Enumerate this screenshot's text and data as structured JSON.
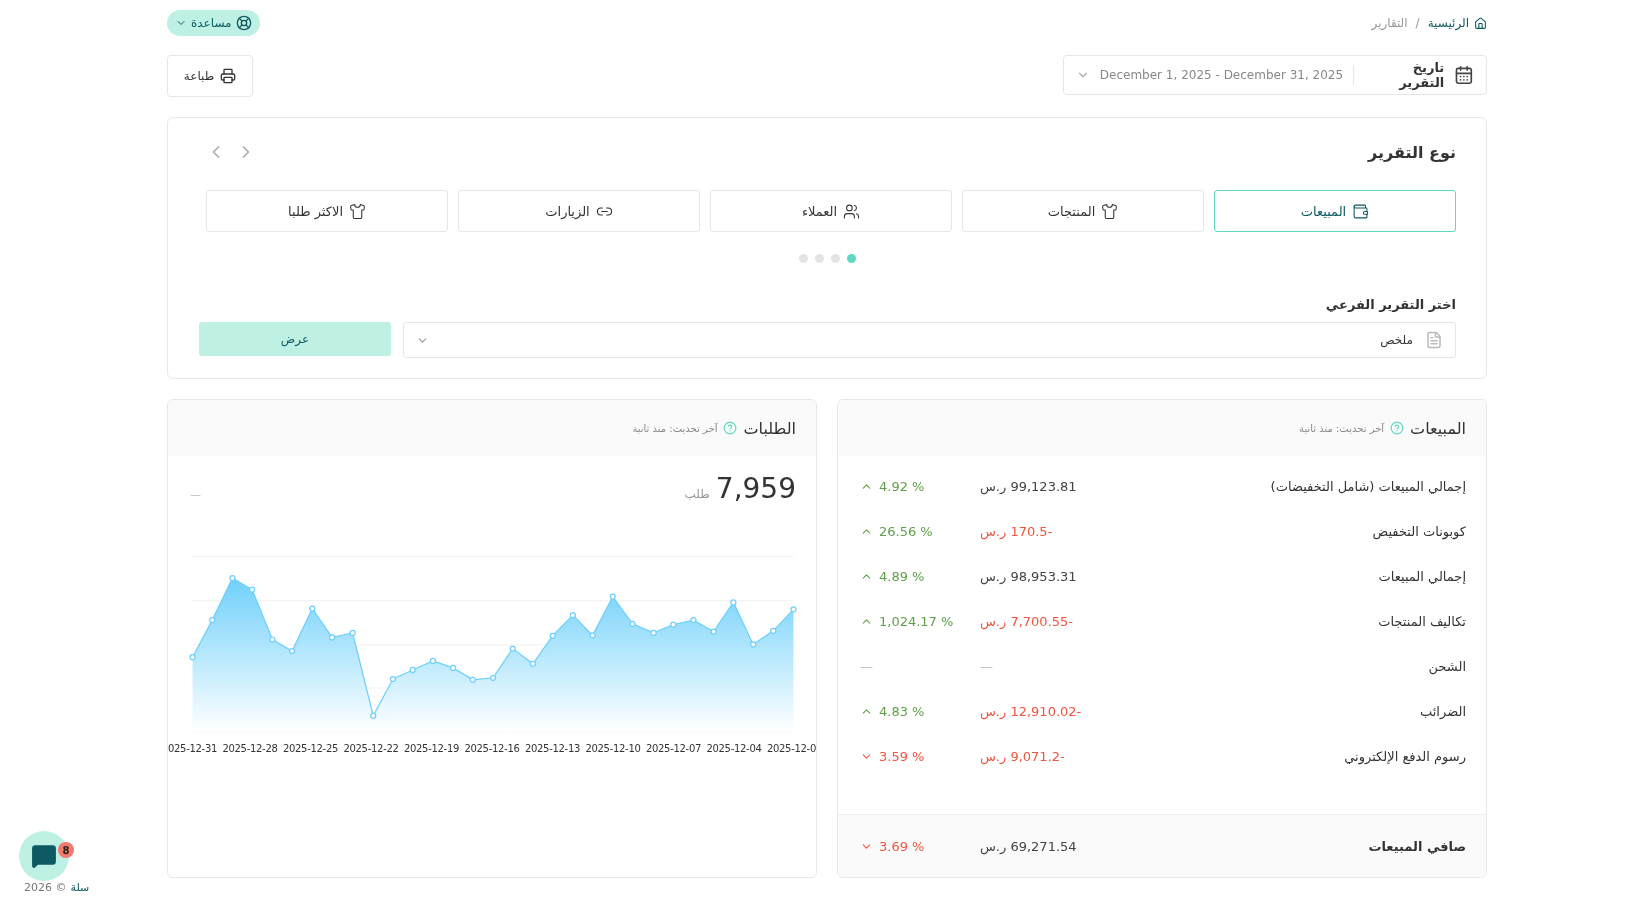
{
  "breadcrumb": {
    "home": "الرئيسية",
    "separator": "/",
    "current": "التقارير"
  },
  "help_button": {
    "label": "مساعدة"
  },
  "date_picker": {
    "label": "تاريخ التقرير",
    "value": "December 1, 2025 - December 31, 2025"
  },
  "print_button": {
    "label": "طباعة"
  },
  "report_type": {
    "title": "نوع التقرير",
    "tabs": [
      {
        "label": "المبيعات",
        "kind": "wallet",
        "selected": true
      },
      {
        "label": "المنتجات",
        "kind": "shirt",
        "selected": false
      },
      {
        "label": "العملاء",
        "kind": "users",
        "selected": false
      },
      {
        "label": "الزيارات",
        "kind": "link",
        "selected": false
      },
      {
        "label": "الاكثر طلبا",
        "kind": "shirt",
        "selected": false
      }
    ],
    "pager_dots": [
      {
        "selected": true
      },
      {
        "selected": false
      },
      {
        "selected": false
      },
      {
        "selected": false
      }
    ],
    "subreport_label": "اختر التقرير الفرعي",
    "subreport_value": "ملخص",
    "show_button": "عرض"
  },
  "sales_card": {
    "title": "المبيعات",
    "updated": "آخر تحديث: منذ ثانية",
    "rows": [
      {
        "label": "إجمالي المبيعات (شامل التخفيضات)",
        "amount": "99,123.81 ر.س",
        "negative": false,
        "change": "4.92 %",
        "rising": true,
        "kind": "row"
      },
      {
        "label": "كوبونات التخفيض",
        "amount": "-170.5 ر.س",
        "negative": true,
        "change": "26.56 %",
        "rising": true,
        "kind": "row"
      },
      {
        "label": "إجمالي المبيعات",
        "amount": "98,953.31 ر.س",
        "negative": false,
        "change": "4.89 %",
        "rising": true,
        "kind": "row"
      },
      {
        "label": "تكاليف المنتجات",
        "amount": "-7,700.55 ر.س",
        "negative": true,
        "change": "1,024.17 %",
        "rising": true,
        "kind": "row"
      },
      {
        "label": "الشحن",
        "amount": "—",
        "change": "—",
        "kind": "empty"
      },
      {
        "label": "الضرائب",
        "amount": "-12,910.02 ر.س",
        "negative": true,
        "change": "4.83 %",
        "rising": true,
        "kind": "row"
      },
      {
        "label": "رسوم الدفع الإلكتروني",
        "amount": "-9,071.2 ر.س",
        "negative": true,
        "change": "3.59 %",
        "rising": false,
        "kind": "row"
      },
      {
        "label": "صافي المبيعات",
        "amount": "69,271.54 ر.س",
        "negative": false,
        "change": "3.69 %",
        "rising": false,
        "kind": "total"
      }
    ]
  },
  "orders_card": {
    "title": "الطلبات",
    "updated": "آخر تحديث: منذ ثانية",
    "total": "7,959",
    "unit": "طلب",
    "side_mark": "—",
    "x_labels": [
      "2025-12-0",
      "2025-12-04",
      "2025-12-07",
      "2025-12-10",
      "2025-12-13",
      "2025-12-16",
      "2025-12-19",
      "2025-12-22",
      "2025-12-25",
      "2025-12-28",
      "025-12-31"
    ]
  },
  "chat_button": {
    "badge": "8"
  },
  "footer": {
    "text": "2026 ©",
    "link": "سلة"
  }
}
